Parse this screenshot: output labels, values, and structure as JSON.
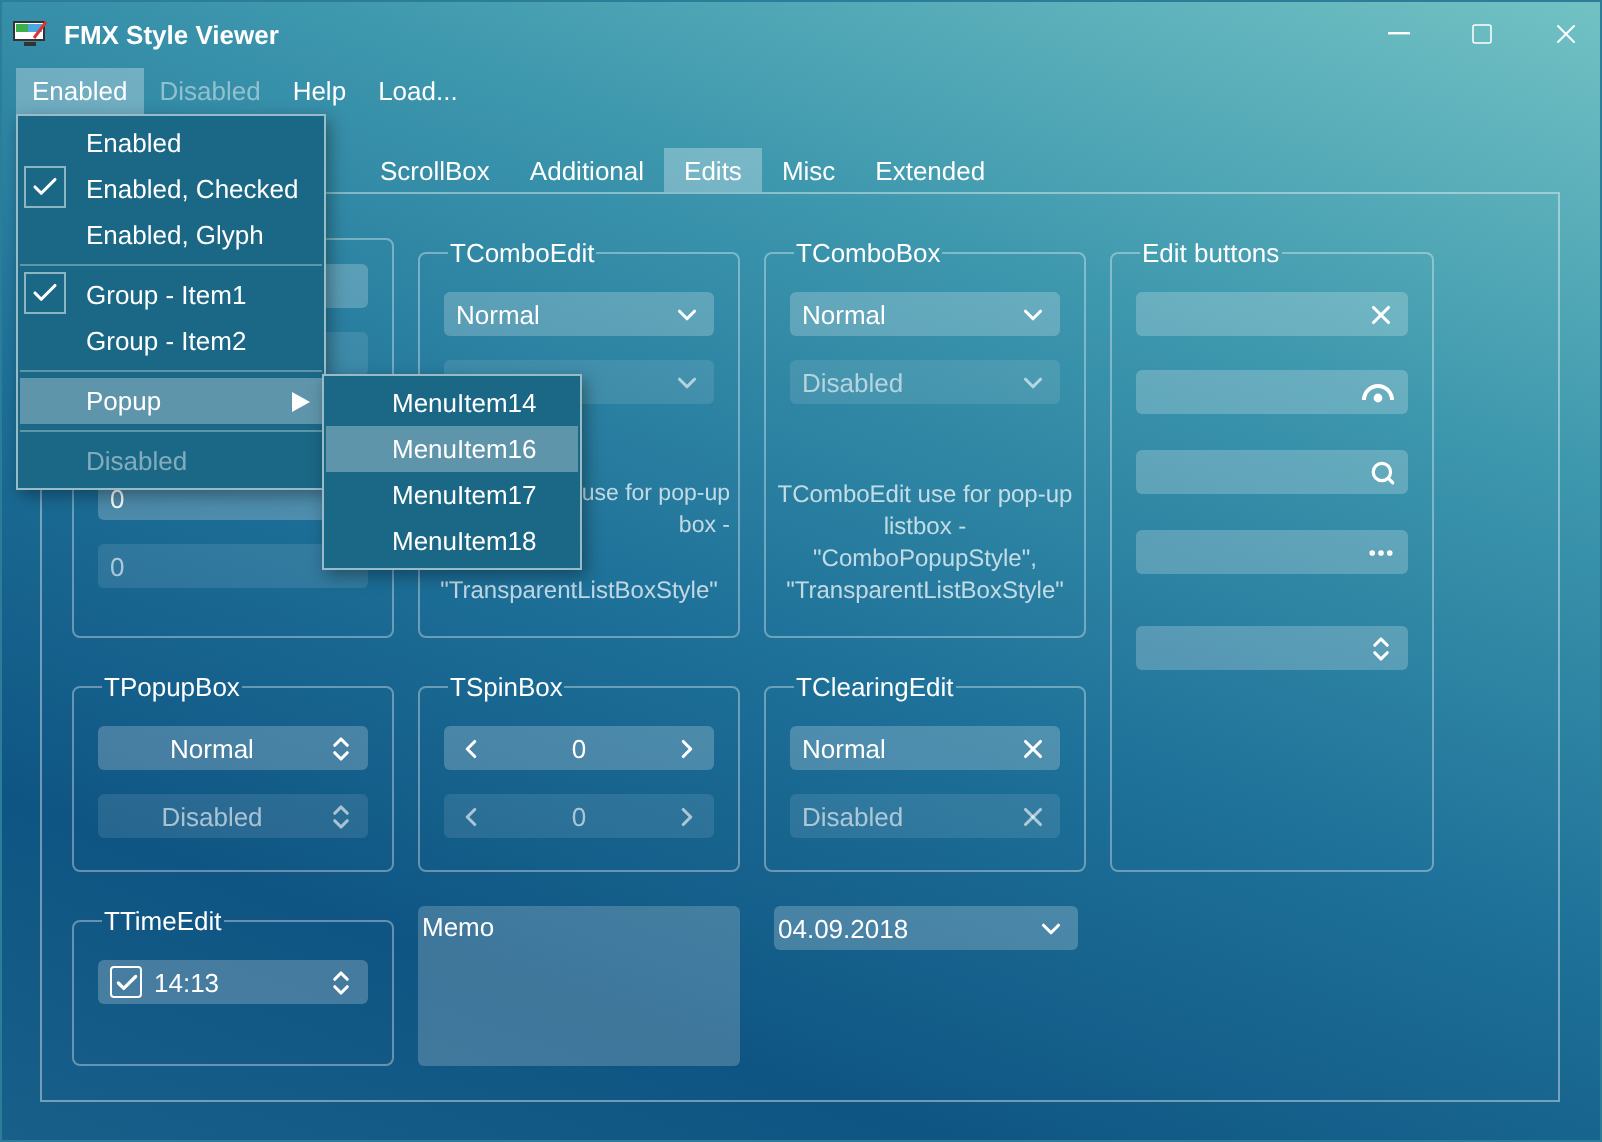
{
  "window": {
    "title": "FMX Style Viewer"
  },
  "menu_bar": [
    {
      "label": "Enabled",
      "selected": true,
      "disabled": false
    },
    {
      "label": "Disabled",
      "selected": false,
      "disabled": true
    },
    {
      "label": "Help",
      "selected": false,
      "disabled": false
    },
    {
      "label": "Load...",
      "selected": false,
      "disabled": false
    }
  ],
  "tabs": [
    {
      "label": "ScrollBox",
      "selected": false
    },
    {
      "label": "Additional",
      "selected": false
    },
    {
      "label": "Edits",
      "selected": true
    },
    {
      "label": "Misc",
      "selected": false
    },
    {
      "label": "Extended",
      "selected": false
    }
  ],
  "panels": [
    {
      "kind": "group",
      "items": [
        {
          "kind": "edit",
          "disabled": false
        },
        {
          "kind": "edit",
          "disabled": true
        },
        {
          "kind": "edit",
          "value": "0",
          "disabled": false
        },
        {
          "kind": "edit",
          "value": "0",
          "disabled": true
        }
      ]
    },
    {
      "kind": "group",
      "title": "TComboEdit",
      "items": [
        {
          "kind": "combo",
          "value": "Normal",
          "disabled": false
        },
        {
          "kind": "combo",
          "disabled": true
        },
        {
          "kind": "fragment",
          "text": "use for pop-up"
        },
        {
          "kind": "fragment",
          "text": "box -"
        },
        {
          "kind": "note",
          "text": "\"TransparentListBoxStyle\""
        }
      ]
    },
    {
      "kind": "group",
      "title": "TComboBox",
      "items": [
        {
          "kind": "combo",
          "value": "Normal",
          "disabled": false
        },
        {
          "kind": "combo",
          "value": "Disabled",
          "disabled": true
        },
        {
          "kind": "note",
          "text": "TComboEdit use for pop-up listbox - \"ComboPopupStyle\", \"TransparentListBoxStyle\""
        }
      ]
    },
    {
      "kind": "tall_group",
      "title": "Edit buttons",
      "items": [
        {
          "kind": "clear_edit"
        },
        {
          "kind": "password_edit"
        },
        {
          "kind": "search_edit"
        },
        {
          "kind": "ellipsis_edit"
        },
        {
          "kind": "spin_edit"
        }
      ]
    },
    {
      "kind": "group",
      "title": "TPopupBox",
      "items": [
        {
          "kind": "popup",
          "value": "Normal",
          "disabled": false
        },
        {
          "kind": "popup",
          "value": "Disabled",
          "disabled": true
        }
      ]
    },
    {
      "kind": "group",
      "title": "TSpinBox",
      "items": [
        {
          "kind": "spin",
          "value": "0",
          "disabled": false
        },
        {
          "kind": "spin",
          "value": "0",
          "disabled": true
        }
      ]
    },
    {
      "kind": "group",
      "title": "TClearingEdit",
      "items": [
        {
          "kind": "clearing",
          "value": "Normal",
          "disabled": false
        },
        {
          "kind": "clearing",
          "value": "Disabled",
          "disabled": true
        }
      ]
    },
    {
      "kind": "group",
      "title": "TTimeEdit",
      "items": [
        {
          "kind": "time",
          "value": "14:13",
          "checked": true
        }
      ]
    },
    {
      "kind": "memo",
      "text": "Memo"
    },
    {
      "kind": "date",
      "value": "04.09.2018"
    }
  ],
  "open_menu": {
    "items": [
      {
        "kind": "item",
        "label": "Enabled",
        "checked": false,
        "selected": false,
        "disabled": false,
        "submenu": false
      },
      {
        "kind": "item",
        "label": "Enabled, Checked",
        "checked": true,
        "selected": false,
        "disabled": false,
        "submenu": false
      },
      {
        "kind": "item",
        "label": "Enabled, Glyph",
        "checked": false,
        "selected": false,
        "disabled": false,
        "submenu": false
      },
      {
        "kind": "separator"
      },
      {
        "kind": "item",
        "label": "Group - Item1",
        "checked": true,
        "selected": false,
        "disabled": false,
        "submenu": false
      },
      {
        "kind": "item",
        "label": "Group - Item2",
        "checked": false,
        "selected": false,
        "disabled": false,
        "submenu": false
      },
      {
        "kind": "separator"
      },
      {
        "kind": "item",
        "label": "Popup",
        "checked": false,
        "selected": true,
        "disabled": false,
        "submenu": true
      },
      {
        "kind": "separator"
      },
      {
        "kind": "item",
        "label": "Disabled",
        "checked": false,
        "selected": false,
        "disabled": true,
        "submenu": false
      }
    ]
  },
  "submenu": {
    "items": [
      {
        "label": "MenuItem14",
        "selected": false
      },
      {
        "label": "MenuItem16",
        "selected": true
      },
      {
        "label": "MenuItem17",
        "selected": false
      },
      {
        "label": "MenuItem18",
        "selected": false
      }
    ]
  }
}
